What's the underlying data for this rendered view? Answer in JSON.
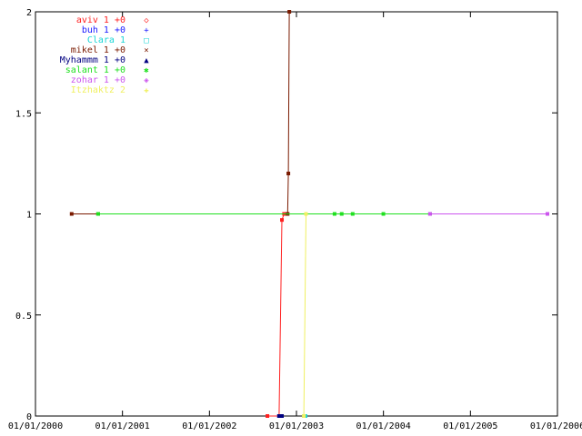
{
  "chart_data": {
    "type": "line",
    "title": "",
    "xlabel": "",
    "ylabel": "",
    "x_tick_labels": [
      "01/01/2000",
      "01/01/2001",
      "01/01/2002",
      "01/01/2003",
      "01/01/2004",
      "01/01/2005",
      "01/01/2006"
    ],
    "y_tick_labels": [
      "0",
      "0.5",
      "1",
      "1.5",
      "2"
    ],
    "y_ticks": [
      0,
      0.5,
      1,
      1.5,
      2
    ],
    "xlim": [
      "2000-01-01",
      "2006-01-01"
    ],
    "ylim": [
      0,
      2
    ],
    "grid": false,
    "legend_position": "top-left",
    "series": [
      {
        "name": "aviv 1 +0",
        "color": "#ff2020",
        "marker": "◇",
        "points": [
          [
            "2002-09-01",
            0
          ],
          [
            "2002-10-20",
            0
          ],
          [
            "2002-11-01",
            0.97
          ],
          [
            "2002-11-10",
            1
          ],
          [
            "2002-11-20",
            1
          ]
        ]
      },
      {
        "name": "buh 1 +0",
        "color": "#1a1aff",
        "marker": "+",
        "points": [
          [
            "2002-10-20",
            0
          ],
          [
            "2002-10-28",
            0
          ]
        ]
      },
      {
        "name": "Clara 1",
        "color": "#1ad6d6",
        "marker": "□",
        "points": [
          [
            "2003-02-01",
            0
          ],
          [
            "2003-02-08",
            0
          ]
        ]
      },
      {
        "name": "mikel 1 +0",
        "color": "#7a1a00",
        "marker": "×",
        "points": [
          [
            "2000-06-01",
            1
          ],
          [
            "2000-09-20",
            1
          ],
          [
            "2002-11-25",
            1
          ],
          [
            "2002-11-28",
            1.2
          ],
          [
            "2002-12-02",
            2
          ]
        ]
      },
      {
        "name": "Myhammm 1 +0",
        "color": "#000080",
        "marker": "▲",
        "points": [
          [
            "2002-10-20",
            0
          ],
          [
            "2002-11-01",
            0
          ]
        ]
      },
      {
        "name": "salant 1 +0",
        "color": "#20e020",
        "marker": "✱",
        "points": [
          [
            "2000-09-20",
            1
          ],
          [
            "2003-06-10",
            1
          ],
          [
            "2003-07-10",
            1
          ],
          [
            "2003-08-25",
            1
          ],
          [
            "2004-01-01",
            1
          ],
          [
            "2004-07-15",
            1
          ]
        ]
      },
      {
        "name": "zohar 1 +0",
        "color": "#cc55ee",
        "marker": "◈",
        "points": [
          [
            "2004-07-15",
            1
          ],
          [
            "2005-11-20",
            1
          ]
        ]
      },
      {
        "name": "Itzhaktz 2",
        "color": "#f0f060",
        "marker": "✚",
        "points": [
          [
            "2003-02-01",
            0
          ],
          [
            "2003-02-10",
            1
          ]
        ]
      }
    ]
  }
}
